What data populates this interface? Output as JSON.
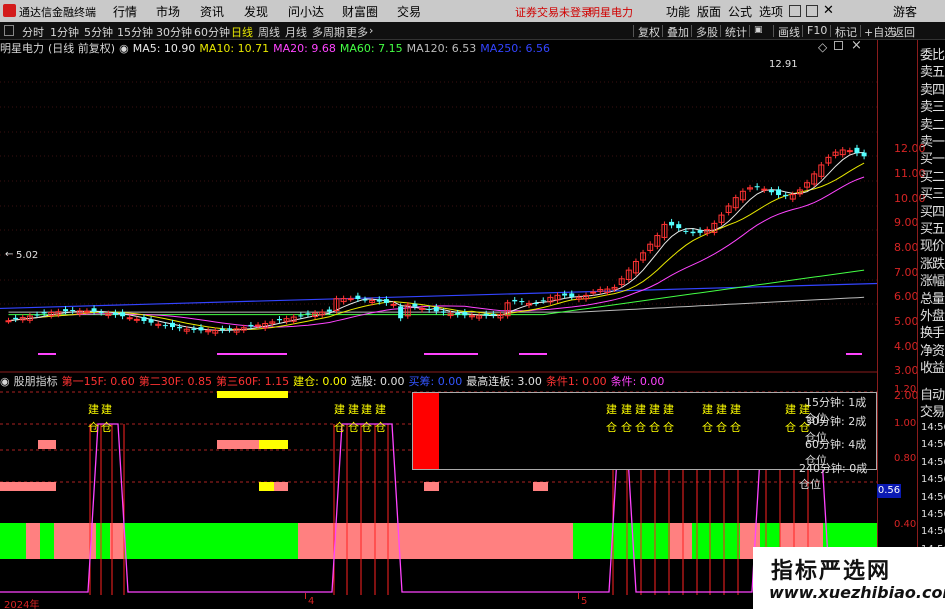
{
  "app": {
    "title": "通达信金融终端",
    "menus": [
      "行情",
      "市场",
      "资讯",
      "发现",
      "问小达",
      "财富圈",
      "交易"
    ],
    "notice": "证券交易未登录",
    "stock_notice": "明星电力",
    "right_menus": [
      "功能",
      "版面",
      "公式",
      "选项"
    ],
    "guest": "游客"
  },
  "periods": [
    "分时",
    "1分钟",
    "5分钟",
    "15分钟",
    "30分钟",
    "60分钟",
    "日线",
    "周线",
    "月线",
    "多周期",
    "更多"
  ],
  "active_period": "日线",
  "tools": [
    "复权",
    "叠加",
    "多股",
    "统计",
    "画线",
    "F10",
    "标记",
    "+自选",
    "返回"
  ],
  "main_header": {
    "stock": "明星电力",
    "mode": "(日线 前复权)",
    "ma": [
      {
        "label": "MA5: 10.90",
        "color": "#e8e8e8"
      },
      {
        "label": "MA10: 10.71",
        "color": "#e8e800"
      },
      {
        "label": "MA20: 9.68",
        "color": "#ff44ff"
      },
      {
        "label": "MA60: 7.15",
        "color": "#44ff44"
      },
      {
        "label": "MA120: 6.53",
        "color": "#bbbbbb"
      },
      {
        "label": "MA250: 6.56",
        "color": "#3344ff"
      }
    ]
  },
  "ind_header": {
    "name": "股朋指标",
    "items": [
      {
        "label": "第一15F: 0.60",
        "color": "#ff3333"
      },
      {
        "label": "第二30F: 0.85",
        "color": "#ff3333"
      },
      {
        "label": "第三60F: 1.15",
        "color": "#ff3333"
      },
      {
        "label": "建仓: 0.00",
        "color": "#ffff00"
      },
      {
        "label": "选股: 0.00",
        "color": "#e0e0e0"
      },
      {
        "label": "买筹: 0.00",
        "color": "#3355ff"
      },
      {
        "label": "最高连板: 3.00",
        "color": "#e0e0e0"
      },
      {
        "label": "条件1: 0.00",
        "color": "#ff3333"
      },
      {
        "label": "条件: 0.00",
        "color": "#ff44ff"
      }
    ]
  },
  "annotations": {
    "high": "12.91",
    "low": "5.02"
  },
  "yaxis_main": [
    "12.00",
    "11.00",
    "10.00",
    "9.00",
    "8.00",
    "7.00",
    "6.00",
    "5.00",
    "4.00",
    "3.00",
    "2.00"
  ],
  "yaxis_ind": [
    "1.20",
    "1.00",
    "0.80",
    "0.56",
    "0.40",
    "0.20"
  ],
  "ind_current": "0.56",
  "xaxis": [
    "2024年",
    "4",
    "5"
  ],
  "side_labels": [
    "委比",
    "卖五",
    "卖四",
    "卖三",
    "卖二",
    "卖一",
    "买一",
    "买二",
    "买三",
    "买四",
    "买五",
    "现价",
    "涨跌",
    "涨幅",
    "总量",
    "外盘",
    "换手",
    "净资",
    "收益"
  ],
  "side_bottom": [
    "自动",
    "交易"
  ],
  "side_times": [
    "14:56",
    "14:56",
    "14:56",
    "14:56",
    "14:56",
    "14:56",
    "14:56",
    "14:56",
    "14:56"
  ],
  "cang_panel": [
    {
      "label": "15分钟: 1成仓位"
    },
    {
      "label": "30分钟: 2成仓位"
    },
    {
      "label": "60分钟: 4成仓位"
    },
    {
      "label": "240分钟: 0成仓位"
    }
  ],
  "jian_label": "建",
  "cang_label": "仓",
  "watermark": {
    "cn": "指标严选网",
    "url": "www.xuezhibiao.com"
  }
}
